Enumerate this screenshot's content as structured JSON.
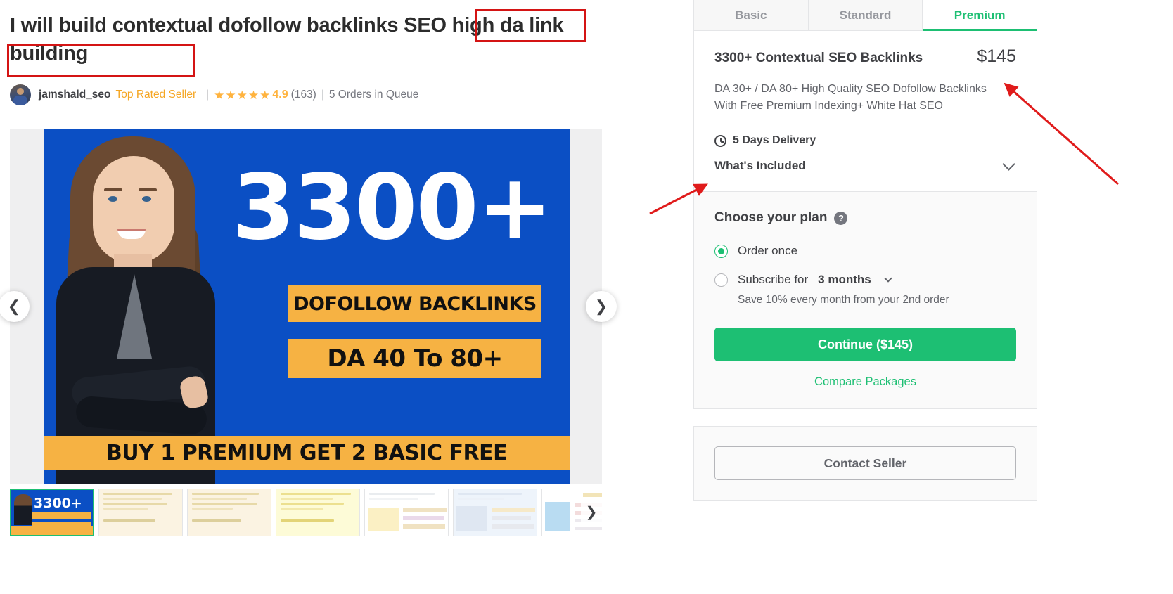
{
  "gig": {
    "title": "I will build contextual dofollow backlinks SEO high da link building",
    "highlight_color": "#d41414"
  },
  "seller": {
    "avatar_icon": "user-avatar",
    "username": "jamshald_seo",
    "badge": "Top Rated Seller",
    "stars": [
      "★",
      "★",
      "★",
      "★",
      "★"
    ],
    "rating": "4.9",
    "reviews_count": "(163)",
    "orders_in_queue": "5 Orders in Queue",
    "separator": "|"
  },
  "gallery": {
    "prev_icon": "chevron-left-icon",
    "next_icon": "chevron-right-icon",
    "slide": {
      "headline": "3300+",
      "bar_one": "DOFOLLOW BACKLINKS",
      "bar_two": "DA 40 To 80+",
      "bar_three": "BUY 1 PREMIUM GET 2 BASIC FREE",
      "bg_color": "#0b4fc4",
      "accent_color": "#f6b243"
    },
    "thumbs_next_icon": "chevron-right-icon",
    "thumbnails": [
      {
        "label": "thumb-gig-cover",
        "kind": "cover",
        "active": true
      },
      {
        "label": "thumb-report-1",
        "kind": "sheet-cream"
      },
      {
        "label": "thumb-report-2",
        "kind": "sheet-cream"
      },
      {
        "label": "thumb-report-3",
        "kind": "sheet-yellow"
      },
      {
        "label": "thumb-report-4",
        "kind": "sheet-white"
      },
      {
        "label": "thumb-report-5",
        "kind": "sheet-blue"
      },
      {
        "label": "thumb-report-6",
        "kind": "sheet-white"
      }
    ]
  },
  "package": {
    "tabs": [
      {
        "label": "Basic",
        "active": false
      },
      {
        "label": "Standard",
        "active": false
      },
      {
        "label": "Premium",
        "active": true
      }
    ],
    "accent_color": "#1dbf73",
    "name": "3300+ Contextual SEO Backlinks",
    "price": "$145",
    "description": "DA 30+ / DA 80+ High Quality SEO Dofollow Backlinks With Free Premium Indexing+ White Hat SEO",
    "delivery_icon": "clock-icon",
    "delivery": "5 Days Delivery",
    "whats_included": "What's Included",
    "whats_included_icon": "chevron-down-icon"
  },
  "plan": {
    "title": "Choose your plan",
    "help_icon": "question-mark-icon",
    "help_glyph": "?",
    "options": [
      {
        "label": "Order once",
        "selected": true
      },
      {
        "label": "Subscribe for",
        "strong": "3 months",
        "selected": false,
        "icon": "chevron-down-icon"
      }
    ],
    "save_note": "Save 10% every month from your 2nd order",
    "continue_label": "Continue ($145)",
    "compare_label": "Compare Packages"
  },
  "contact": {
    "button_label": "Contact Seller"
  },
  "annotations": {
    "arrow_color": "#e01b1b",
    "arrow_to_delivery": "arrow-pointing-to-delivery",
    "arrow_to_price": "arrow-pointing-to-price"
  }
}
